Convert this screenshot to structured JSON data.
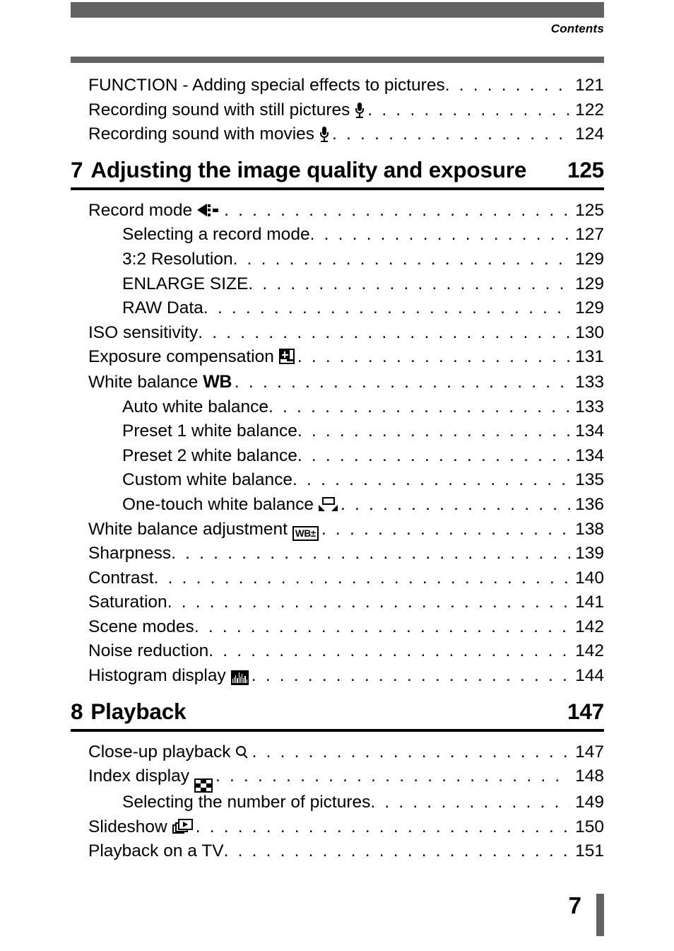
{
  "header": {
    "label": "Contents"
  },
  "footer": {
    "page_number": "7"
  },
  "leader_dots": ". . . . . . . . . . . . . . . . . . . . . . . . . . . . . . . . . . . . . . . . . . . . . . . . . . . . . . . . . . . . . . . . . . . . . . . .",
  "sections": [
    {
      "type": "entries",
      "items": [
        {
          "level": 1,
          "label": "FUNCTION - Adding special effects to pictures",
          "icon": null,
          "page": "121"
        },
        {
          "level": 1,
          "label": "Recording sound with still pictures",
          "icon": "microphone-icon",
          "page": "122"
        },
        {
          "level": 1,
          "label": "Recording sound with movies",
          "icon": "microphone-icon",
          "page": "124"
        }
      ]
    },
    {
      "type": "chapter",
      "number": "7",
      "title": "Adjusting the image quality and exposure",
      "page": "125",
      "items": [
        {
          "level": 1,
          "label": "Record mode",
          "icon": "record-mode-icon",
          "page": "125"
        },
        {
          "level": 2,
          "label": "Selecting a record mode",
          "icon": null,
          "page": "127"
        },
        {
          "level": 2,
          "label": "3:2 Resolution",
          "icon": null,
          "page": "129"
        },
        {
          "level": 2,
          "label": "ENLARGE SIZE",
          "icon": null,
          "page": "129"
        },
        {
          "level": 2,
          "label": "RAW Data",
          "icon": null,
          "page": "129"
        },
        {
          "level": 1,
          "label": "ISO sensitivity",
          "icon": null,
          "page": "130"
        },
        {
          "level": 1,
          "label": "Exposure compensation",
          "icon": "exposure-compensation-icon",
          "page": "131"
        },
        {
          "level": 1,
          "label": "White balance",
          "icon": "wb-icon",
          "page": "133"
        },
        {
          "level": 2,
          "label": "Auto white balance",
          "icon": null,
          "page": "133"
        },
        {
          "level": 2,
          "label": "Preset 1 white balance",
          "icon": null,
          "page": "134"
        },
        {
          "level": 2,
          "label": "Preset 2 white balance",
          "icon": null,
          "page": "134"
        },
        {
          "level": 2,
          "label": "Custom white balance",
          "icon": null,
          "page": "135"
        },
        {
          "level": 2,
          "label": "One-touch white balance",
          "icon": "one-touch-wb-icon",
          "page": "136"
        },
        {
          "level": 1,
          "label": "White balance adjustment",
          "icon": "wb-adjustment-icon",
          "icon_text": "WB±",
          "page": "138"
        },
        {
          "level": 1,
          "label": "Sharpness",
          "icon": null,
          "page": "139"
        },
        {
          "level": 1,
          "label": "Contrast",
          "icon": null,
          "page": "140"
        },
        {
          "level": 1,
          "label": "Saturation",
          "icon": null,
          "page": "141"
        },
        {
          "level": 1,
          "label": "Scene modes",
          "icon": null,
          "page": "142"
        },
        {
          "level": 1,
          "label": "Noise reduction",
          "icon": null,
          "page": "142"
        },
        {
          "level": 1,
          "label": "Histogram display",
          "icon": "histogram-icon",
          "page": "144"
        }
      ]
    },
    {
      "type": "chapter",
      "number": "8",
      "title": "Playback",
      "page": "147",
      "items": [
        {
          "level": 1,
          "label": "Close-up playback",
          "icon": "magnifier-icon",
          "page": "147"
        },
        {
          "level": 1,
          "label": "Index display",
          "icon": "index-display-icon",
          "page": "148"
        },
        {
          "level": 2,
          "label": "Selecting the number of pictures",
          "icon": null,
          "page": "149"
        },
        {
          "level": 1,
          "label": "Slideshow",
          "icon": "slideshow-icon",
          "page": "150"
        },
        {
          "level": 1,
          "label": "Playback on a TV",
          "icon": null,
          "page": "151"
        }
      ]
    }
  ]
}
